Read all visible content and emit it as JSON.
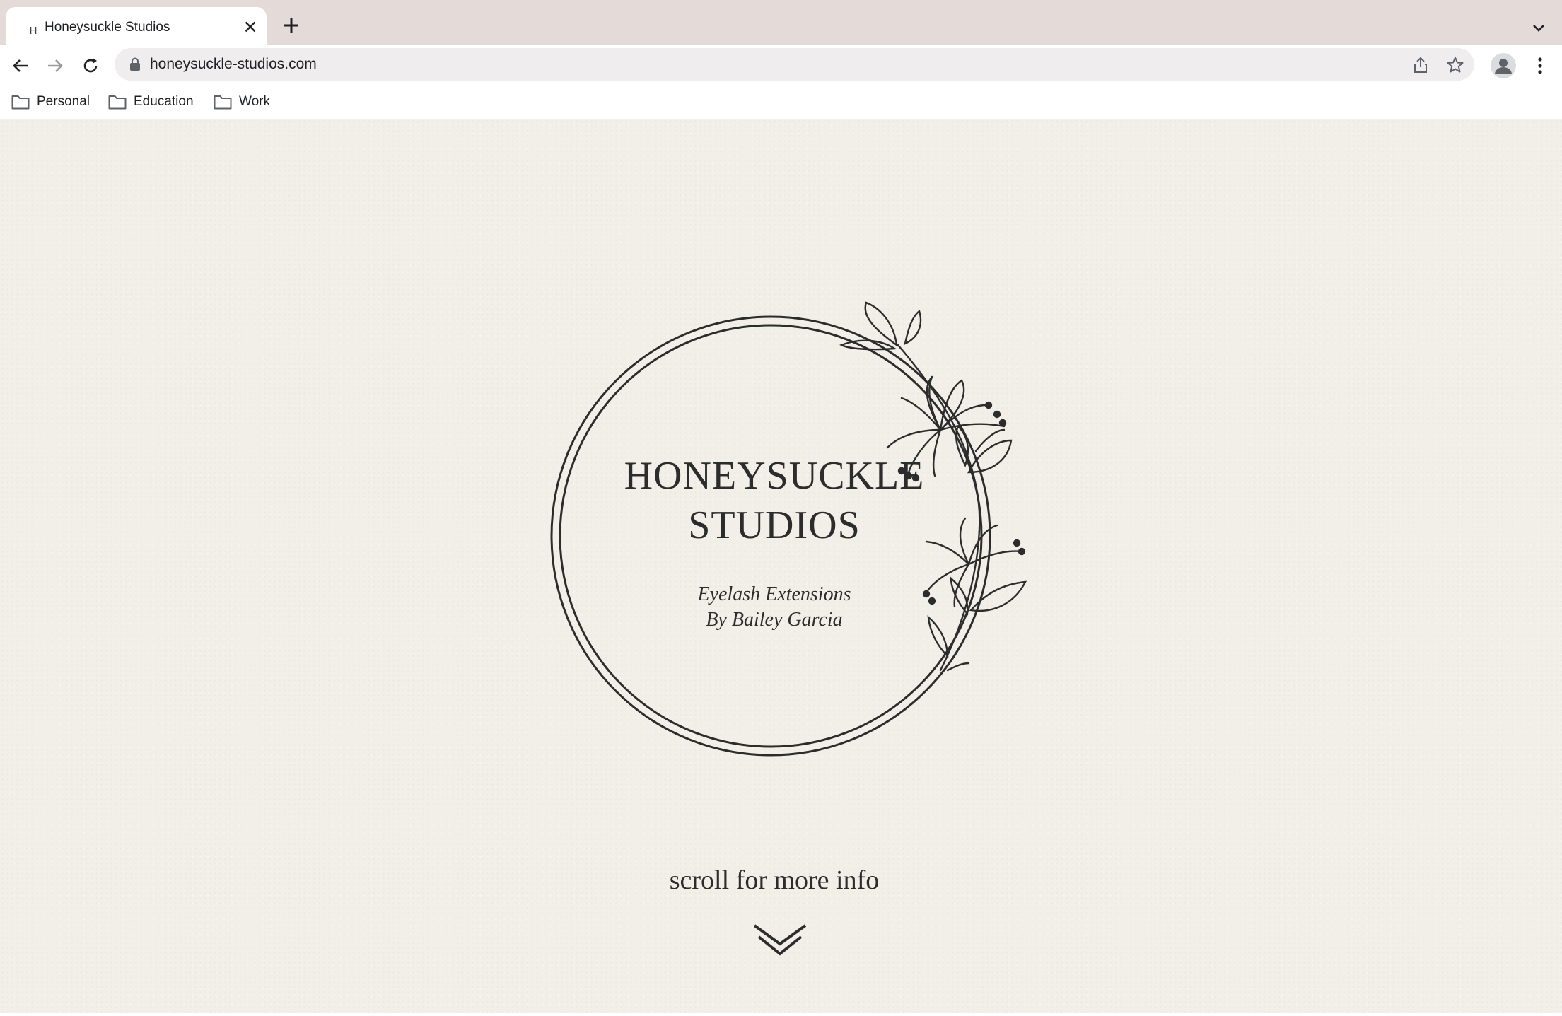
{
  "browser": {
    "tab": {
      "favicon_letter": "H",
      "title": "Honeysuckle Studios",
      "close_glyph": "✕"
    },
    "address_bar": {
      "url": "honeysuckle-studios.com"
    },
    "bookmarks": [
      {
        "label": "Personal"
      },
      {
        "label": "Education"
      },
      {
        "label": "Work"
      }
    ],
    "icons": {
      "back": "arrow-left-icon",
      "forward": "arrow-right-icon",
      "reload": "reload-icon",
      "lock": "lock-icon",
      "share": "share-icon",
      "bookmark": "star-icon",
      "profile": "profile-avatar-icon",
      "menu": "more-vertical-icon",
      "new_tab": "plus-icon",
      "tab_search": "chevron-down-icon",
      "folder": "folder-icon"
    },
    "colors": {
      "tabstrip": "#e4dbd9",
      "omnibox": "#efeded",
      "page_background": "#f1efe8",
      "ink": "#2c2c2c"
    }
  },
  "hero": {
    "brand_line1": "HONEYSUCKLE",
    "brand_line2": "STUDIOS",
    "tagline_line1": "Eyelash Extensions",
    "tagline_line2": "By Bailey Garcia",
    "scroll_text": "scroll for more info"
  }
}
